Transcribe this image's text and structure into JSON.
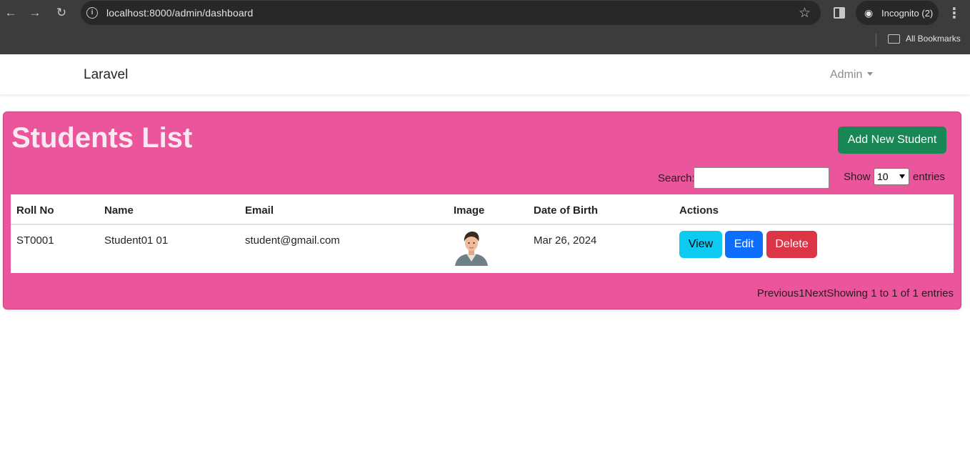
{
  "browser": {
    "url": "localhost:8000/admin/dashboard",
    "incognito_label": "Incognito (2)",
    "bookmarks_label": "All Bookmarks",
    "icons": [
      "back-arrow-icon",
      "forward-arrow-icon",
      "reload-icon",
      "site-info-icon",
      "star-icon",
      "side-panel-icon",
      "incognito-icon",
      "menu-dots-icon",
      "folder-icon"
    ]
  },
  "navbar": {
    "brand": "Laravel",
    "user_menu": "Admin"
  },
  "card": {
    "background_color": "#ea559c",
    "title": "Students List",
    "add_button": "Add New Student",
    "search_label": "Search:",
    "search_value": "",
    "show_label": "Show",
    "page_size": "10",
    "entries_label": "entries"
  },
  "table": {
    "headers": [
      "Roll No",
      "Name",
      "Email",
      "Image",
      "Date of Birth",
      "Actions"
    ],
    "rows": [
      {
        "roll_no": "ST0001",
        "name": "Student01 01",
        "email": "student@gmail.com",
        "image_icon": "student-avatar",
        "dob": "Mar 26, 2024",
        "actions": {
          "view": "View",
          "edit": "Edit",
          "delete": "Delete"
        }
      }
    ]
  },
  "pagination": {
    "previous": "Previous",
    "current_page": "1",
    "next": "Next",
    "info": "Showing 1 to 1 of 1 entries"
  }
}
